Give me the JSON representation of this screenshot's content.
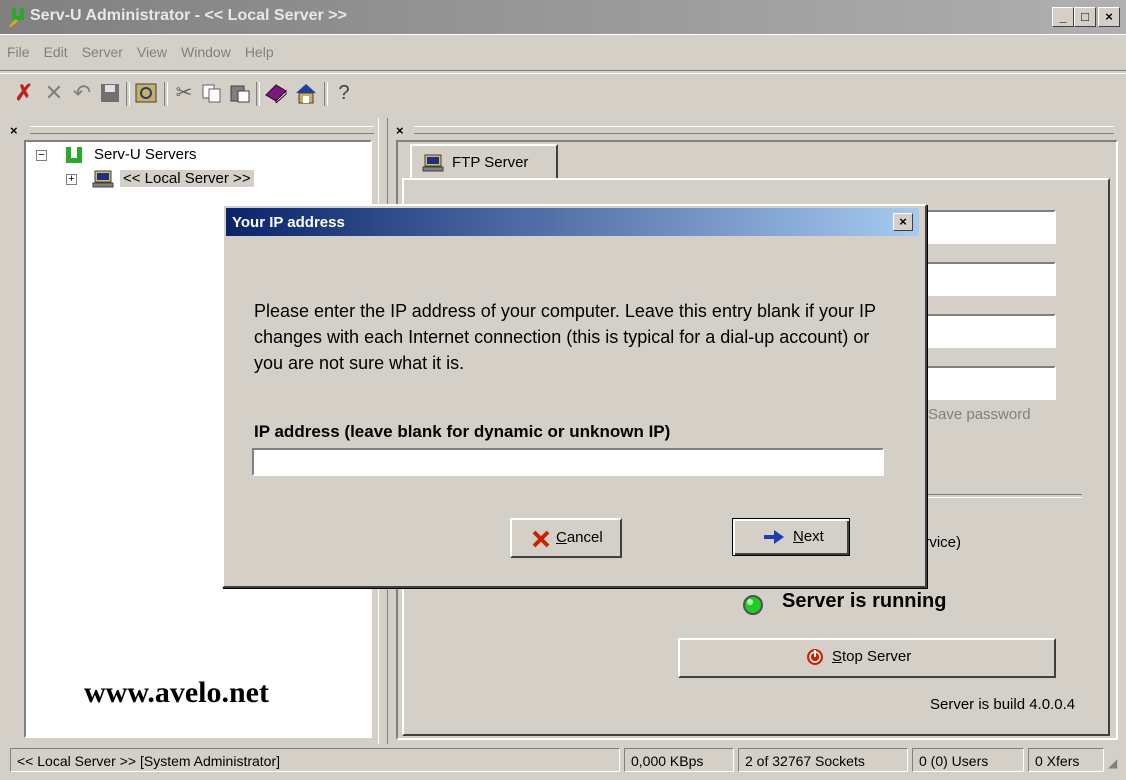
{
  "window": {
    "title": "Serv-U Administrator - << Local Server >>",
    "minimize": "_",
    "maximize": "□",
    "close": "×"
  },
  "menu": [
    "File",
    "Edit",
    "Server",
    "View",
    "Window",
    "Help"
  ],
  "toolbar": {
    "icons": [
      "stop-x-icon",
      "delete-x-icon",
      "undo-icon",
      "save-icon",
      "refresh-icon",
      "cut-icon",
      "copy-icon",
      "paste-icon",
      "book-icon",
      "home-icon",
      "help-icon"
    ]
  },
  "tree": {
    "root_label": "Serv-U Servers",
    "child_label": "<< Local Server >>",
    "expand_root": "−",
    "expand_child": "+"
  },
  "right_pane": {
    "tab_label": "FTP Server",
    "save_password_label": "Save password",
    "service_fragment": "ervice)",
    "status_text": "Server is running",
    "stop_button_label": "Stop Server",
    "stop_button_accel": "S",
    "stop_button_rest": "top Server",
    "build_text": "Server is build 4.0.0.4"
  },
  "watermark": "www.avelo.net",
  "dialog": {
    "title": "Your IP address",
    "message": "Please enter the IP address of your computer. Leave this entry blank if your IP changes with each Internet connection (this is typical for a dial-up account) or you are not sure what it is.",
    "field_label": "IP address (leave blank for dynamic or unknown IP)",
    "field_value": "",
    "cancel_accel": "C",
    "cancel_rest": "ancel",
    "next_accel": "N",
    "next_rest": "ext",
    "close": "×"
  },
  "statusbar": {
    "context": "<< Local Server >>  [System Administrator]",
    "speed": "0,000 KBps",
    "sockets": "2 of 32767 Sockets",
    "users": "0 (0) Users",
    "xfers": "0 Xfers"
  },
  "colors": {
    "dialog_title_start": "#0a246a",
    "dialog_title_end": "#a6caf0",
    "running_led": "#22cc22",
    "stop_icon": "#cc2200",
    "cancel_icon": "#cc2200",
    "next_icon": "#1a3fb0"
  }
}
